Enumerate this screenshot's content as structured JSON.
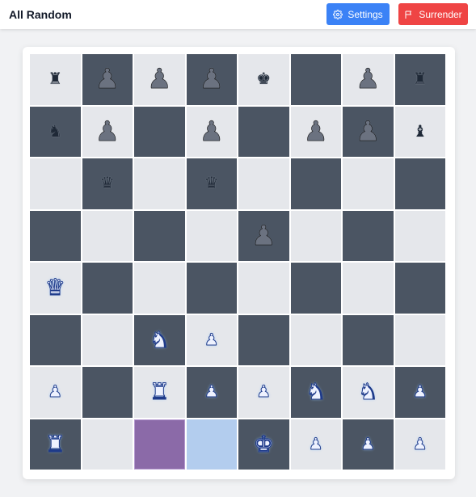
{
  "header": {
    "title": "All Random",
    "settings_label": "Settings",
    "surrender_label": "Surrender",
    "settings_color": "#3b82f6",
    "surrender_color": "#ef4444"
  },
  "board": {
    "light_color": "#e5e7eb",
    "dark_color": "#4b5563",
    "last_move_from_color": "#8b6aa8",
    "last_move_to_color": "#b3cdee",
    "last_move": {
      "from": [
        7,
        2
      ],
      "to": [
        7,
        3
      ]
    },
    "ranks": [
      [
        [
          "black",
          "rook"
        ],
        [
          "black",
          "pawn"
        ],
        [
          "black",
          "pawn"
        ],
        [
          "black",
          "pawn"
        ],
        [
          "black",
          "king"
        ],
        null,
        [
          "black",
          "pawn"
        ],
        [
          "black",
          "rook"
        ]
      ],
      [
        [
          "black",
          "knight"
        ],
        [
          "black",
          "pawn"
        ],
        null,
        [
          "black",
          "pawn"
        ],
        null,
        [
          "black",
          "pawn"
        ],
        [
          "black",
          "pawn"
        ],
        [
          "black",
          "bishop"
        ]
      ],
      [
        null,
        [
          "black",
          "queen"
        ],
        null,
        [
          "black",
          "queen"
        ],
        null,
        null,
        null,
        null
      ],
      [
        null,
        null,
        null,
        null,
        [
          "black",
          "pawn"
        ],
        null,
        null,
        null
      ],
      [
        [
          "white",
          "queen"
        ],
        null,
        null,
        null,
        null,
        null,
        null,
        null
      ],
      [
        null,
        null,
        [
          "white",
          "knight"
        ],
        [
          "white",
          "pawn"
        ],
        null,
        null,
        null,
        null
      ],
      [
        [
          "white",
          "pawn"
        ],
        null,
        [
          "white",
          "rook"
        ],
        [
          "white",
          "pawn"
        ],
        [
          "white",
          "pawn"
        ],
        [
          "white",
          "knight"
        ],
        [
          "white",
          "knight"
        ],
        [
          "white",
          "pawn"
        ]
      ],
      [
        [
          "white",
          "rook"
        ],
        null,
        null,
        null,
        [
          "white",
          "king"
        ],
        [
          "white",
          "pawn"
        ],
        [
          "white",
          "pawn"
        ],
        [
          "white",
          "pawn"
        ]
      ]
    ]
  }
}
